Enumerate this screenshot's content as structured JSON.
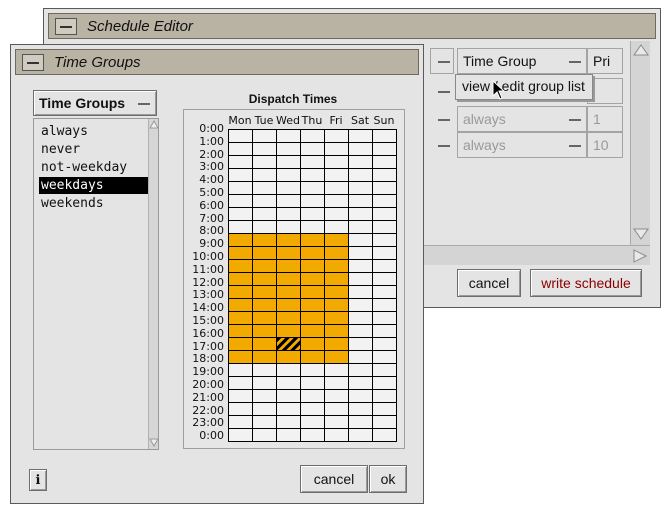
{
  "schedule_editor": {
    "title": "Schedule Editor",
    "header_field": "Time Group",
    "header_pri": "Pri",
    "rows": [
      {
        "group": "always",
        "pri": "1"
      },
      {
        "group": "always",
        "pri": "10"
      }
    ],
    "menu_item": "view / edit group list",
    "cancel": "cancel",
    "write": "write schedule"
  },
  "time_groups": {
    "title": "Time Groups",
    "option_menu": "Time Groups",
    "list": [
      "always",
      "never",
      "not-weekday",
      "weekdays",
      "weekends"
    ],
    "selected": "weekdays",
    "dispatch_title": "Dispatch Times",
    "days": [
      "Mon",
      "Tue",
      "Wed",
      "Thu",
      "Fri",
      "Sat",
      "Sun"
    ],
    "hours": [
      "0:00",
      "1:00",
      "2:00",
      "3:00",
      "4:00",
      "5:00",
      "6:00",
      "7:00",
      "8:00",
      "9:00",
      "10:00",
      "11:00",
      "12:00",
      "13:00",
      "14:00",
      "15:00",
      "16:00",
      "17:00",
      "18:00",
      "19:00",
      "20:00",
      "21:00",
      "22:00",
      "23:00",
      "0:00"
    ],
    "active_days": [
      0,
      1,
      2,
      3,
      4
    ],
    "active_hours": [
      8,
      9,
      10,
      11,
      12,
      13,
      14,
      15,
      16,
      17
    ],
    "highlight_color": "#f2a900",
    "cursor_cell": {
      "day": 2,
      "hour": 16
    },
    "cancel": "cancel",
    "ok": "ok"
  }
}
